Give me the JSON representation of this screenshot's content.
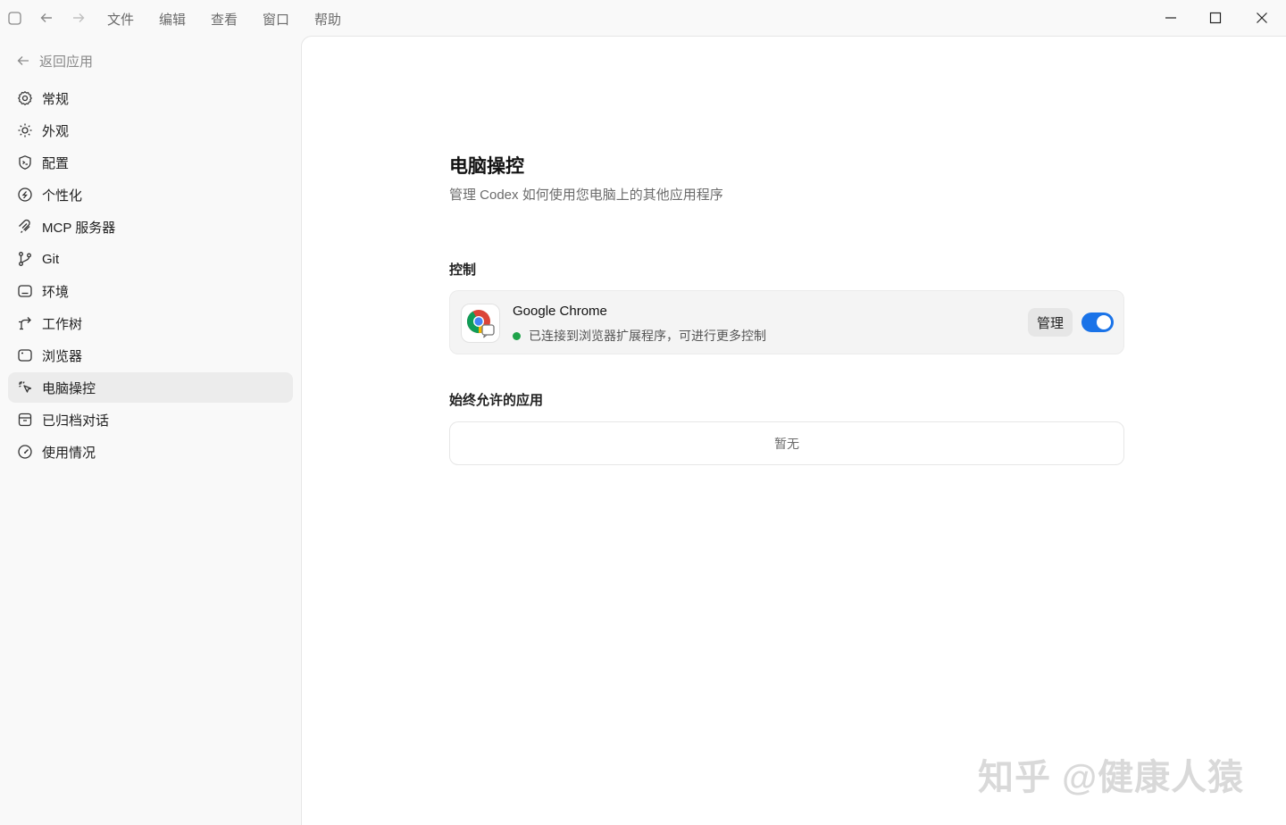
{
  "titlebar": {
    "menu": [
      "文件",
      "编辑",
      "查看",
      "窗口",
      "帮助"
    ]
  },
  "sidebar": {
    "back_label": "返回应用",
    "items": [
      {
        "label": "常规",
        "icon": "gear-icon"
      },
      {
        "label": "外观",
        "icon": "sun-icon"
      },
      {
        "label": "配置",
        "icon": "config-shield-icon"
      },
      {
        "label": "个性化",
        "icon": "personalize-icon"
      },
      {
        "label": "MCP 服务器",
        "icon": "mcp-icon"
      },
      {
        "label": "Git",
        "icon": "git-branch-icon"
      },
      {
        "label": "环境",
        "icon": "environment-icon"
      },
      {
        "label": "工作树",
        "icon": "worktree-icon"
      },
      {
        "label": "浏览器",
        "icon": "browser-icon"
      },
      {
        "label": "电脑操控",
        "icon": "computer-control-icon"
      },
      {
        "label": "已归档对话",
        "icon": "archive-icon"
      },
      {
        "label": "使用情况",
        "icon": "gauge-icon"
      }
    ],
    "active_index": 9
  },
  "main": {
    "title": "电脑操控",
    "subtitle": "管理 Codex 如何使用您电脑上的其他应用程序",
    "control_section_label": "控制",
    "app": {
      "name": "Google Chrome",
      "status": "已连接到浏览器扩展程序，可进行更多控制",
      "manage_label": "管理",
      "enabled": true
    },
    "allowed_section_label": "始终允许的应用",
    "allowed_empty": "暂无"
  },
  "watermark": "知乎 @健康人猿",
  "colors": {
    "accent": "#1a73e8",
    "status_green": "#1fa34a",
    "active_bg": "#ececec"
  }
}
